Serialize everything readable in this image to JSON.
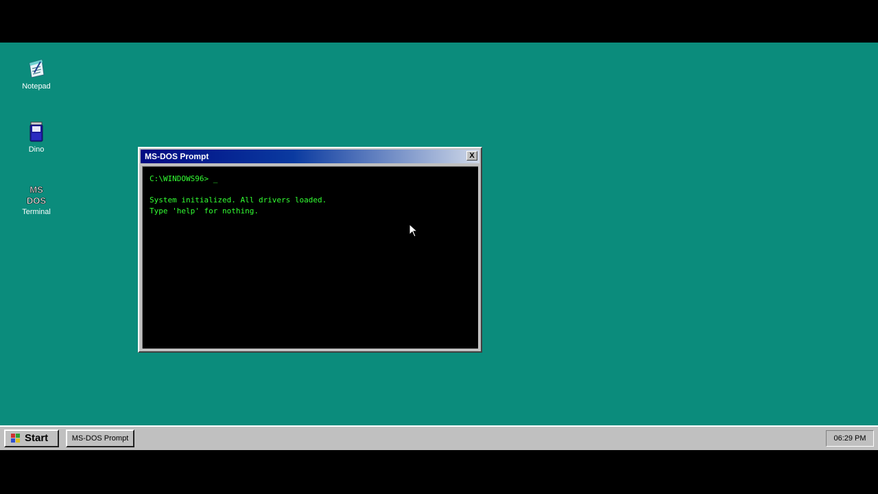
{
  "desktop": {
    "background_color": "#0b8c7c",
    "icons": [
      {
        "label": "Notepad",
        "icon": "notepad-icon"
      },
      {
        "label": "Dino",
        "icon": "dino-icon"
      },
      {
        "label": "Terminal",
        "icon": "terminal-icon"
      }
    ],
    "terminal_icon_text": "MS\nDOS"
  },
  "window": {
    "title": "MS-DOS Prompt",
    "close_label": "X",
    "terminal": {
      "lines": [
        "C:\\WINDOWS96> _",
        "",
        "System initialized. All drivers loaded.",
        "Type 'help' for nothing."
      ],
      "text_color": "#33ff33",
      "background_color": "#000000"
    }
  },
  "taskbar": {
    "start_label": "Start",
    "tasks": [
      {
        "label": "MS-DOS Prompt"
      }
    ],
    "clock": "06:29 PM"
  },
  "cursor": {
    "icon": "mouse-pointer-icon"
  }
}
